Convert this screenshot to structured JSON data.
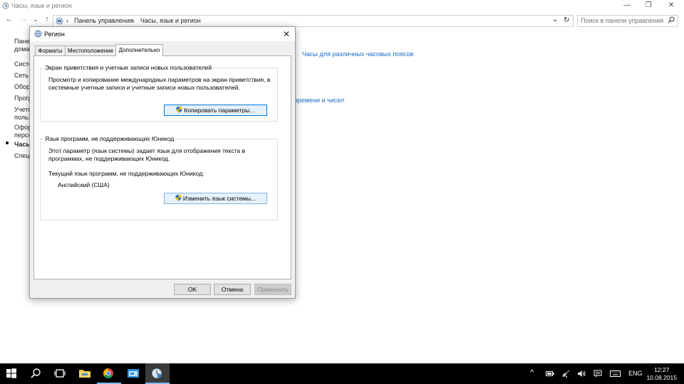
{
  "window": {
    "title": "Часы, язык и регион",
    "minimize": "—",
    "restore": "❐",
    "close": "✕"
  },
  "nav": {
    "back": "←",
    "forward": "→",
    "recent": "⌄",
    "up": "↑",
    "crumb_sep": "›",
    "breadcrumb": [
      "Панель управления",
      "Часы, язык и регион"
    ],
    "dropdown": "⌄",
    "refresh": "↻"
  },
  "search": {
    "placeholder": "Поиск в панели управления"
  },
  "left_nav": {
    "items": [
      "Панел",
      "домаш",
      "Систе",
      "Сеть и",
      "Обору",
      "Прогр",
      "Учетн",
      "польз",
      "Офорн",
      "персо",
      "Часы",
      "Специ"
    ]
  },
  "main_links": {
    "time_zones": "Часы для различных часовых поясов",
    "time_numbers": "времени и чисел"
  },
  "dialog": {
    "title": "Регион",
    "close": "✕",
    "tabs": [
      "Форматы",
      "Местоположение",
      "Дополнительно"
    ],
    "active_tab": "Дополнительно",
    "welcome": {
      "title": "Экран приветствия и учетные записи новых пользователей",
      "text_line1": "Просмотр и копирование международных параметров на экран приветствия, в",
      "text_line2": "системные учетные записи и учетные записи новых пользователей.",
      "button": "Копировать параметры..."
    },
    "nonunicode": {
      "title": "Язык программ, не поддерживающих Юникод",
      "text_line1": "Этот параметр (язык системы) задает язык для отображения текста в",
      "text_line2": "программах, не поддерживающих Юникод.",
      "current_label": "Текущий язык программ, не поддерживающих Юникод:",
      "current_value": "Английский (США)",
      "button": "Изменить язык системы..."
    },
    "ok": "OK",
    "cancel": "Отмена",
    "apply": "Применить"
  },
  "taskbar": {
    "lang": "ENG",
    "time": "12:27",
    "date": "10.08.2015",
    "tray_chevron": "^"
  },
  "colors": {
    "link": "#1a6fc4",
    "focus": "#0078d7",
    "taskbar": "#000000"
  }
}
